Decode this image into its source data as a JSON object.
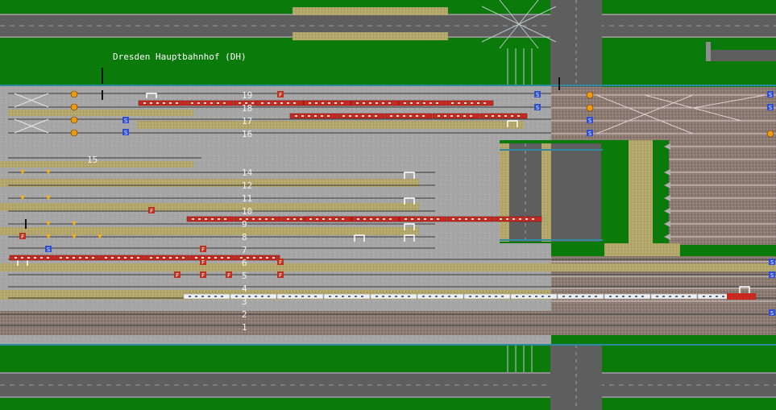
{
  "station": {
    "name": "Dresden Hauptbahnhof (DH)"
  },
  "tracks": [
    {
      "number": "19"
    },
    {
      "number": "18"
    },
    {
      "number": "17"
    },
    {
      "number": "16"
    },
    {
      "number": "15"
    },
    {
      "number": "14"
    },
    {
      "number": "12"
    },
    {
      "number": "11"
    },
    {
      "number": "10"
    },
    {
      "number": "9"
    },
    {
      "number": "8"
    },
    {
      "number": "7"
    },
    {
      "number": "6"
    },
    {
      "number": "5"
    },
    {
      "number": "4"
    },
    {
      "number": "3"
    },
    {
      "number": "2"
    },
    {
      "number": "1"
    }
  ],
  "markers": {
    "s_badge": "S",
    "f_badge": "F"
  },
  "colors": {
    "grass": "#0a7a0a",
    "platform": "#a9a9a9",
    "road": "#6b6b6b",
    "sand": "#b8a96a",
    "s_badge": "#2f4fd6",
    "f_badge": "#c0301e",
    "regional_train": "#c8281e",
    "ice_train": "#f0f0f0",
    "catenary": "#2e8aa0"
  }
}
